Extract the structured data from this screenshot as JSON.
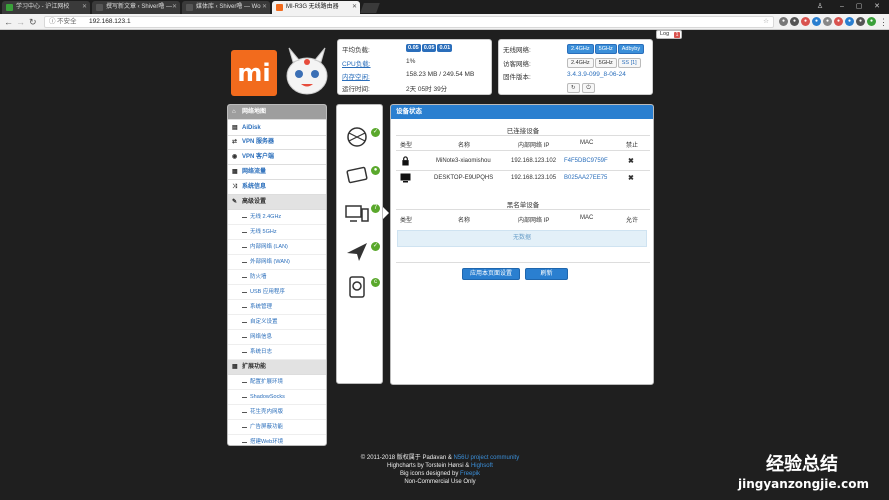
{
  "browser": {
    "tabs": [
      {
        "title": "学习中心 - 沪江网校",
        "fav": "#3aa03a"
      },
      {
        "title": "撰写新文章 ‹ Shiver噜 — ",
        "fav": "#555"
      },
      {
        "title": "媒体库 ‹ Shiver噜 — Wo",
        "fav": "#555"
      },
      {
        "title": "MI-R3G 无线路由器",
        "fav": "#f26b1d"
      }
    ],
    "url": "192.168.123.1",
    "secure_label": "不安全"
  },
  "status_left": {
    "load_label": "平均负载:",
    "load_values": [
      "0.05",
      "0.05",
      "0.01"
    ],
    "cpu_label": "CPU负载:",
    "cpu_value": "1%",
    "mem_label": "内存空闲:",
    "mem_value": "158.23 MB / 249.54 MB",
    "uptime_label": "运行时间:",
    "uptime_value": "2天 05时 39分"
  },
  "status_right": {
    "wifi_label": "无线网络:",
    "wifi_buttons": [
      "2.4GHz",
      "5GHz",
      "Adbyby"
    ],
    "guest_label": "访客网络:",
    "guest_buttons": [
      "2.4GHz",
      "5GHz",
      "SS [1]"
    ],
    "firmware_label": "固件版本:",
    "firmware_value": "3.4.3.9-099_8-06-24"
  },
  "log_button": {
    "label": "Log",
    "count": "1"
  },
  "sidebar": {
    "items": [
      {
        "label": "网络地图",
        "icon": "home-icon",
        "kind": "active"
      },
      {
        "label": "AiDisk",
        "icon": "disk-icon",
        "kind": "item"
      },
      {
        "label": "VPN 服务器",
        "icon": "vpn-icon",
        "kind": "item"
      },
      {
        "label": "VPN 客户端",
        "icon": "globe-icon",
        "kind": "item"
      },
      {
        "label": "网络流量",
        "icon": "chart-icon",
        "kind": "item"
      },
      {
        "label": "系统信息",
        "icon": "shuffle-icon",
        "kind": "item"
      },
      {
        "label": "高级设置",
        "icon": "wrench-icon",
        "kind": "header"
      },
      {
        "label": "无线 2.4GHz",
        "kind": "sub"
      },
      {
        "label": "无线 5GHz",
        "kind": "sub"
      },
      {
        "label": "内部网络 (LAN)",
        "kind": "sub"
      },
      {
        "label": "外部网络 (WAN)",
        "kind": "sub"
      },
      {
        "label": "防火墙",
        "kind": "sub"
      },
      {
        "label": "USB 应用程序",
        "kind": "sub"
      },
      {
        "label": "系统管理",
        "kind": "sub"
      },
      {
        "label": "自定义设置",
        "kind": "sub"
      },
      {
        "label": "网络信息",
        "kind": "sub"
      },
      {
        "label": "系统日志",
        "kind": "sub"
      },
      {
        "label": "扩展功能",
        "icon": "grid-icon",
        "kind": "header"
      },
      {
        "label": "配置扩展环境",
        "kind": "sub"
      },
      {
        "label": "ShadowSocks",
        "kind": "sub"
      },
      {
        "label": "花生壳内网版",
        "kind": "sub"
      },
      {
        "label": "广告屏蔽功能",
        "kind": "sub"
      },
      {
        "label": "搭建Web环境",
        "kind": "sub"
      }
    ]
  },
  "main": {
    "title": "设备状态",
    "connected_title": "已连接设备",
    "connected_headers": [
      "类型",
      "名称",
      "内部网络 IP",
      "MAC",
      "禁止"
    ],
    "devices": [
      {
        "name": "MiNote3-xiaomishou",
        "ip": "192.168.123.102",
        "mac": "F4F5DBC9759F",
        "type_icon": "lock-icon",
        "block_icon": "x-icon"
      },
      {
        "name": "DESKTOP-E9UPQHS",
        "ip": "192.168.123.105",
        "mac": "B025AA27EE75",
        "type_icon": "monitor-icon",
        "block_icon": "x-icon"
      }
    ],
    "blacklist_title": "黑名单设备",
    "blacklist_headers": [
      "类型",
      "名称",
      "内部网络 IP",
      "MAC",
      "允许"
    ],
    "empty_text": "无数据",
    "apply_button": "应用本页面设置",
    "refresh_button": "刷新"
  },
  "footer": {
    "line1_a": "© 2011-2018 版权属于 Padavan & ",
    "line1_link": "N56U project community",
    "line2_a": "Highcharts by Torstein Hønsi & ",
    "line2_link": "Highsoft",
    "line3_a": "Big icons designed by ",
    "line3_link": "Freepik",
    "line4": "Non-Commercial Use Only"
  },
  "logo": {
    "text": "mi"
  },
  "watermark": {
    "line1": "经验总结",
    "line2": "jingyanzongjie.com"
  }
}
